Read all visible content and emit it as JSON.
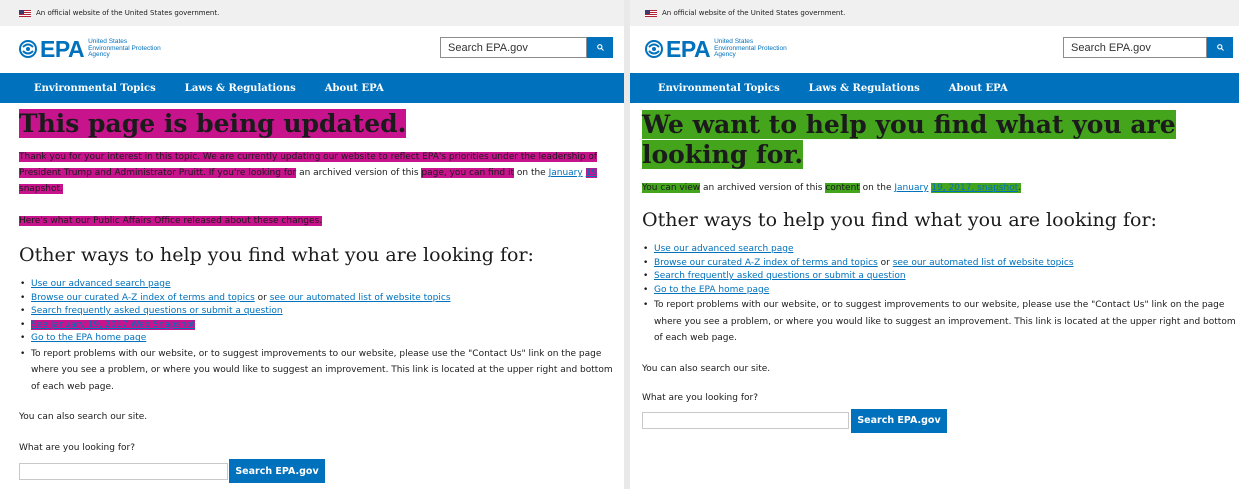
{
  "gov_banner": "An official website of the United States government.",
  "logo": {
    "acronym": "EPA",
    "agency_line1": "United States",
    "agency_line2": "Environmental Protection",
    "agency_line3": "Agency"
  },
  "search": {
    "placeholder": "Search EPA.gov"
  },
  "nav": {
    "items": [
      "Environmental Topics",
      "Laws & Regulations",
      "About EPA"
    ]
  },
  "colors": {
    "epa_blue": "#0071bc",
    "highlight_removed": "#c7148d",
    "highlight_added": "#44a41c"
  },
  "left": {
    "title": "This page is being updated.",
    "intro": {
      "hl1": "Thank you for your interest in this topic. We are currently updating our website to reflect EPA's priorities under the leadership of President Trump and Administrator Pruitt. If you're looking for",
      "t1": " an archived version of this ",
      "hl2": "page, you can find it",
      "t2": " on the ",
      "link1": "January",
      "t3": " ",
      "link2_hl": "19",
      "t4": " ",
      "hl3": "snapshot."
    },
    "press": "Here's what our Public Affairs Office released about these changes.",
    "other_title": "Other ways to help you find what you are looking for:",
    "list": {
      "l1": "Use our advanced search page",
      "l2a": "Browse our curated A-Z index of terms and topics",
      "l2_or": " or ",
      "l2b": "see our automated list of website topics",
      "l3": "Search frequently asked questions or submit a question",
      "l4": "See January 19, 2017 Web Snapshot",
      "l5": "Go to the EPA home page",
      "l6": "To report problems with our website, or to suggest improvements to our website, please use the \"Contact Us\" link on the page where you see a problem, or where you would like to suggest an improvement. This link is located at the upper right and bottom of each web page."
    },
    "also": "You can also search our site.",
    "looking": "What are you looking for?",
    "button": "Search EPA.gov"
  },
  "right": {
    "title": "We want to help you find what you are looking for.",
    "intro": {
      "hl1": "You can view",
      "t1": " an archived version of this ",
      "hl2": "content",
      "t2": " on the ",
      "link1": "January",
      "t3": " ",
      "hl3": "19, 2017, snapshot",
      "t4": "."
    },
    "other_title": "Other ways to help you find what you are looking for:",
    "list": {
      "l1": "Use our advanced search page",
      "l2a": "Browse our curated A-Z index of terms and topics",
      "l2_or": " or ",
      "l2b": "see our automated list of website topics",
      "l3": "Search frequently asked questions or submit a question",
      "l5": "Go to the EPA home page",
      "l6": "To report problems with our website, or to suggest improvements to our website, please use the \"Contact Us\" link on the page where you see a problem, or where you would like to suggest an improvement. This link is located at the upper right and bottom of each web page."
    },
    "also": "You can also search our site.",
    "looking": "What are you looking for?",
    "button": "Search EPA.gov"
  }
}
